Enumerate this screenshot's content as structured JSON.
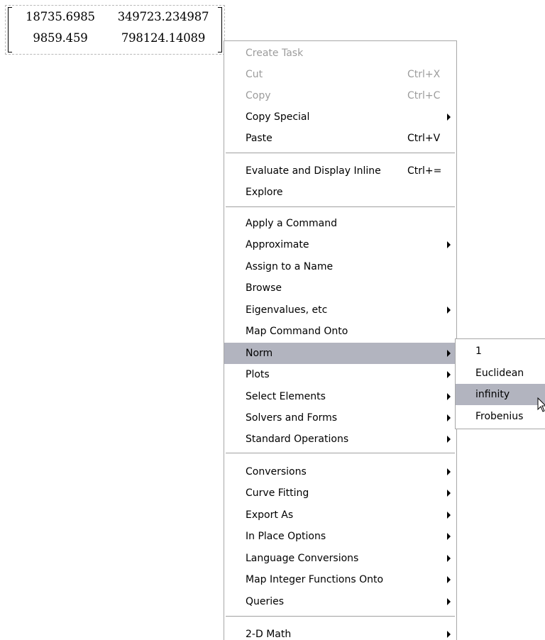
{
  "matrix": {
    "rows": [
      [
        "18735.6985",
        "349723.234987"
      ],
      [
        "9859.459",
        "798124.14089"
      ]
    ]
  },
  "context_menu": {
    "items": [
      {
        "label": "Create Task",
        "shortcut": "",
        "submenu": false,
        "disabled": true
      },
      {
        "label": "Cut",
        "shortcut": "Ctrl+X",
        "submenu": false,
        "disabled": true
      },
      {
        "label": "Copy",
        "shortcut": "Ctrl+C",
        "submenu": false,
        "disabled": true
      },
      {
        "label": "Copy Special",
        "shortcut": "",
        "submenu": true,
        "disabled": false
      },
      {
        "label": "Paste",
        "shortcut": "Ctrl+V",
        "submenu": false,
        "disabled": false
      },
      {
        "label": "Evaluate and Display Inline",
        "shortcut": "Ctrl+=",
        "submenu": false,
        "disabled": false
      },
      {
        "label": "Explore",
        "shortcut": "",
        "submenu": false,
        "disabled": false
      },
      {
        "label": "Apply a Command",
        "shortcut": "",
        "submenu": false,
        "disabled": false
      },
      {
        "label": "Approximate",
        "shortcut": "",
        "submenu": true,
        "disabled": false
      },
      {
        "label": "Assign to a Name",
        "shortcut": "",
        "submenu": false,
        "disabled": false
      },
      {
        "label": "Browse",
        "shortcut": "",
        "submenu": false,
        "disabled": false
      },
      {
        "label": "Eigenvalues, etc",
        "shortcut": "",
        "submenu": true,
        "disabled": false
      },
      {
        "label": "Map Command Onto",
        "shortcut": "",
        "submenu": false,
        "disabled": false
      },
      {
        "label": "Norm",
        "shortcut": "",
        "submenu": true,
        "disabled": false,
        "highlighted": true
      },
      {
        "label": "Plots",
        "shortcut": "",
        "submenu": true,
        "disabled": false
      },
      {
        "label": "Select Elements",
        "shortcut": "",
        "submenu": true,
        "disabled": false
      },
      {
        "label": "Solvers and Forms",
        "shortcut": "",
        "submenu": true,
        "disabled": false
      },
      {
        "label": "Standard Operations",
        "shortcut": "",
        "submenu": true,
        "disabled": false
      },
      {
        "label": "Conversions",
        "shortcut": "",
        "submenu": true,
        "disabled": false
      },
      {
        "label": "Curve Fitting",
        "shortcut": "",
        "submenu": true,
        "disabled": false
      },
      {
        "label": "Export As",
        "shortcut": "",
        "submenu": true,
        "disabled": false
      },
      {
        "label": "In Place Options",
        "shortcut": "",
        "submenu": true,
        "disabled": false
      },
      {
        "label": "Language Conversions",
        "shortcut": "",
        "submenu": true,
        "disabled": false
      },
      {
        "label": "Map Integer Functions Onto",
        "shortcut": "",
        "submenu": true,
        "disabled": false
      },
      {
        "label": "Queries",
        "shortcut": "",
        "submenu": true,
        "disabled": false
      },
      {
        "label": "2-D Math",
        "shortcut": "",
        "submenu": true,
        "disabled": false
      }
    ]
  },
  "norm_submenu": {
    "items": [
      {
        "label": "1",
        "highlighted": false
      },
      {
        "label": "Euclidean",
        "highlighted": false
      },
      {
        "label": "infinity",
        "highlighted": true
      },
      {
        "label": "Frobenius",
        "highlighted": false
      }
    ]
  },
  "colors": {
    "highlight": "#b2b4bf",
    "disabled_text": "#9c9c9c",
    "menu_border": "#a7a7a7"
  },
  "icons": {
    "submenu_arrow": "submenu-arrow-icon",
    "cursor": "mouse-pointer-icon"
  }
}
